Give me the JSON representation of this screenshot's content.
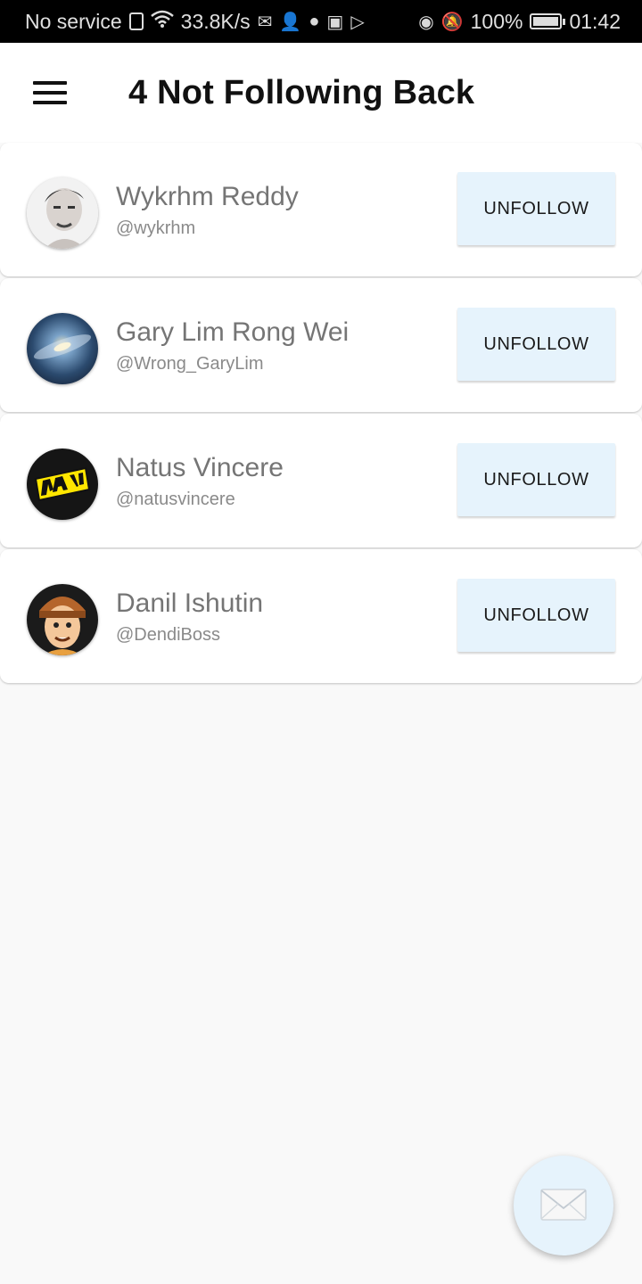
{
  "status_bar": {
    "carrier": "No service",
    "speed": "33.8K/s",
    "battery": "100%",
    "time": "01:42"
  },
  "app_bar": {
    "title": "4 Not Following Back"
  },
  "users": [
    {
      "name": "Wykrhm Reddy",
      "handle": "@wykrhm",
      "action": "UNFOLLOW"
    },
    {
      "name": "Gary Lim Rong Wei",
      "handle": "@Wrong_GaryLim",
      "action": "UNFOLLOW"
    },
    {
      "name": "Natus Vincere",
      "handle": "@natusvincere",
      "action": "UNFOLLOW"
    },
    {
      "name": "Danil Ishutin",
      "handle": "@DendiBoss",
      "action": "UNFOLLOW"
    }
  ],
  "icons": {
    "menu": "hamburger-icon",
    "fab": "mail-icon"
  },
  "colors": {
    "accent": "#e6f3fc",
    "title": "#111111",
    "name": "#757575"
  }
}
